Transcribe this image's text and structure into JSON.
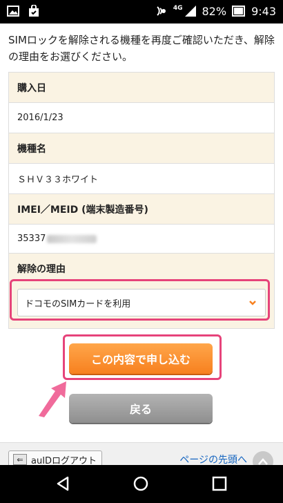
{
  "status_bar": {
    "network": "4G",
    "battery": "82%",
    "time": "9:43"
  },
  "intro": {
    "text": "SIMロックを解除される機種を再度ご確認いただき、解除の理由をお選びください。"
  },
  "table": {
    "purchase_date_label": "購入日",
    "purchase_date_value": "2016/1/23",
    "model_label": "機種名",
    "model_value": "ＳＨＶ３３ホワイト",
    "imei_label": "IMEI／MEID (端末製造番号)",
    "imei_value_visible": "35337",
    "reason_label": "解除の理由"
  },
  "reason_select": {
    "selected": "ドコモのSIMカードを利用"
  },
  "buttons": {
    "submit": "この内容で申し込む",
    "back": "戻る"
  },
  "footer": {
    "logout": "auIDログアウト",
    "page_top": "ページの先頭へ"
  },
  "colors": {
    "highlight": "#e6437a",
    "orange": "#f7801f",
    "label_bg": "#faf3e3"
  }
}
